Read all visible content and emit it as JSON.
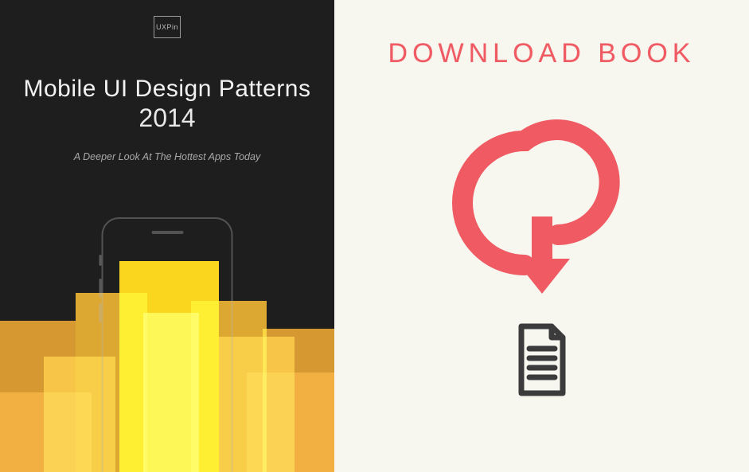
{
  "cover": {
    "brand": "UXPin",
    "title_line1": "Mobile UI Design Patterns",
    "title_line2": "2014",
    "subtitle": "A Deeper Look At The Hottest Apps Today"
  },
  "download": {
    "heading": "DOWNLOAD BOOK"
  },
  "colors": {
    "accent": "#ef5a63",
    "cover_bg": "#1e1e1e",
    "right_bg": "#f7f6ef",
    "doc_icon": "#3b3b3b"
  }
}
